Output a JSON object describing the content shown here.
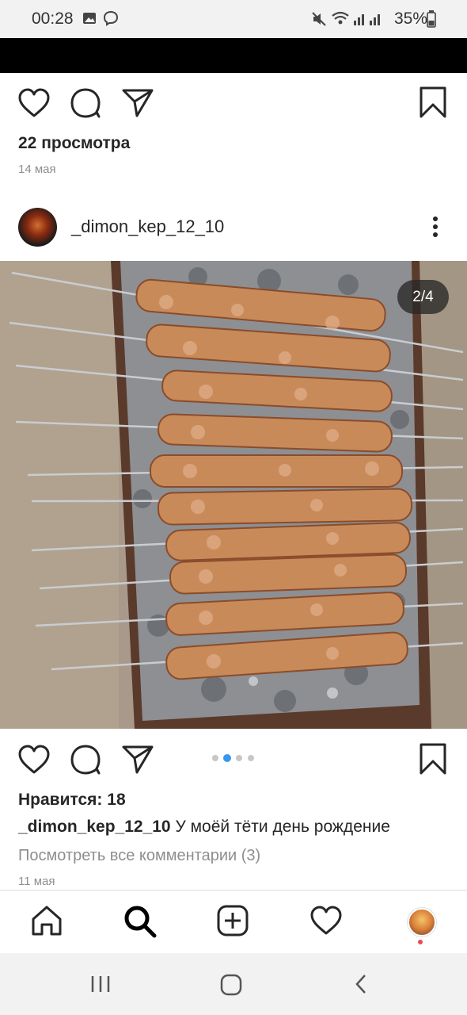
{
  "status_bar": {
    "time": "00:28",
    "battery": "35%"
  },
  "post_top": {
    "views": "22 просмотра",
    "date": "14 мая"
  },
  "post": {
    "username": "_dimon_kep_12_10",
    "counter": "2/4",
    "carousel_total": 4,
    "carousel_active": 2,
    "likes": "Нравится: 18",
    "caption_user": "_dimon_kep_12_10",
    "caption_text": " У моёй тёти день рождение",
    "comments_link": "Посмотреть все комментарии (3)",
    "date": "11 мая"
  },
  "icons": {
    "like": "heart-icon",
    "comment": "comment-icon",
    "share": "send-icon",
    "save": "bookmark-icon",
    "more": "more-vertical-icon",
    "home": "home-icon",
    "search": "search-icon",
    "add": "add-post-icon",
    "activity": "heart-icon",
    "profile": "avatar"
  },
  "colors": {
    "accent": "#3897f0",
    "notification": "#ed4956",
    "muted": "#8e8e8e"
  }
}
